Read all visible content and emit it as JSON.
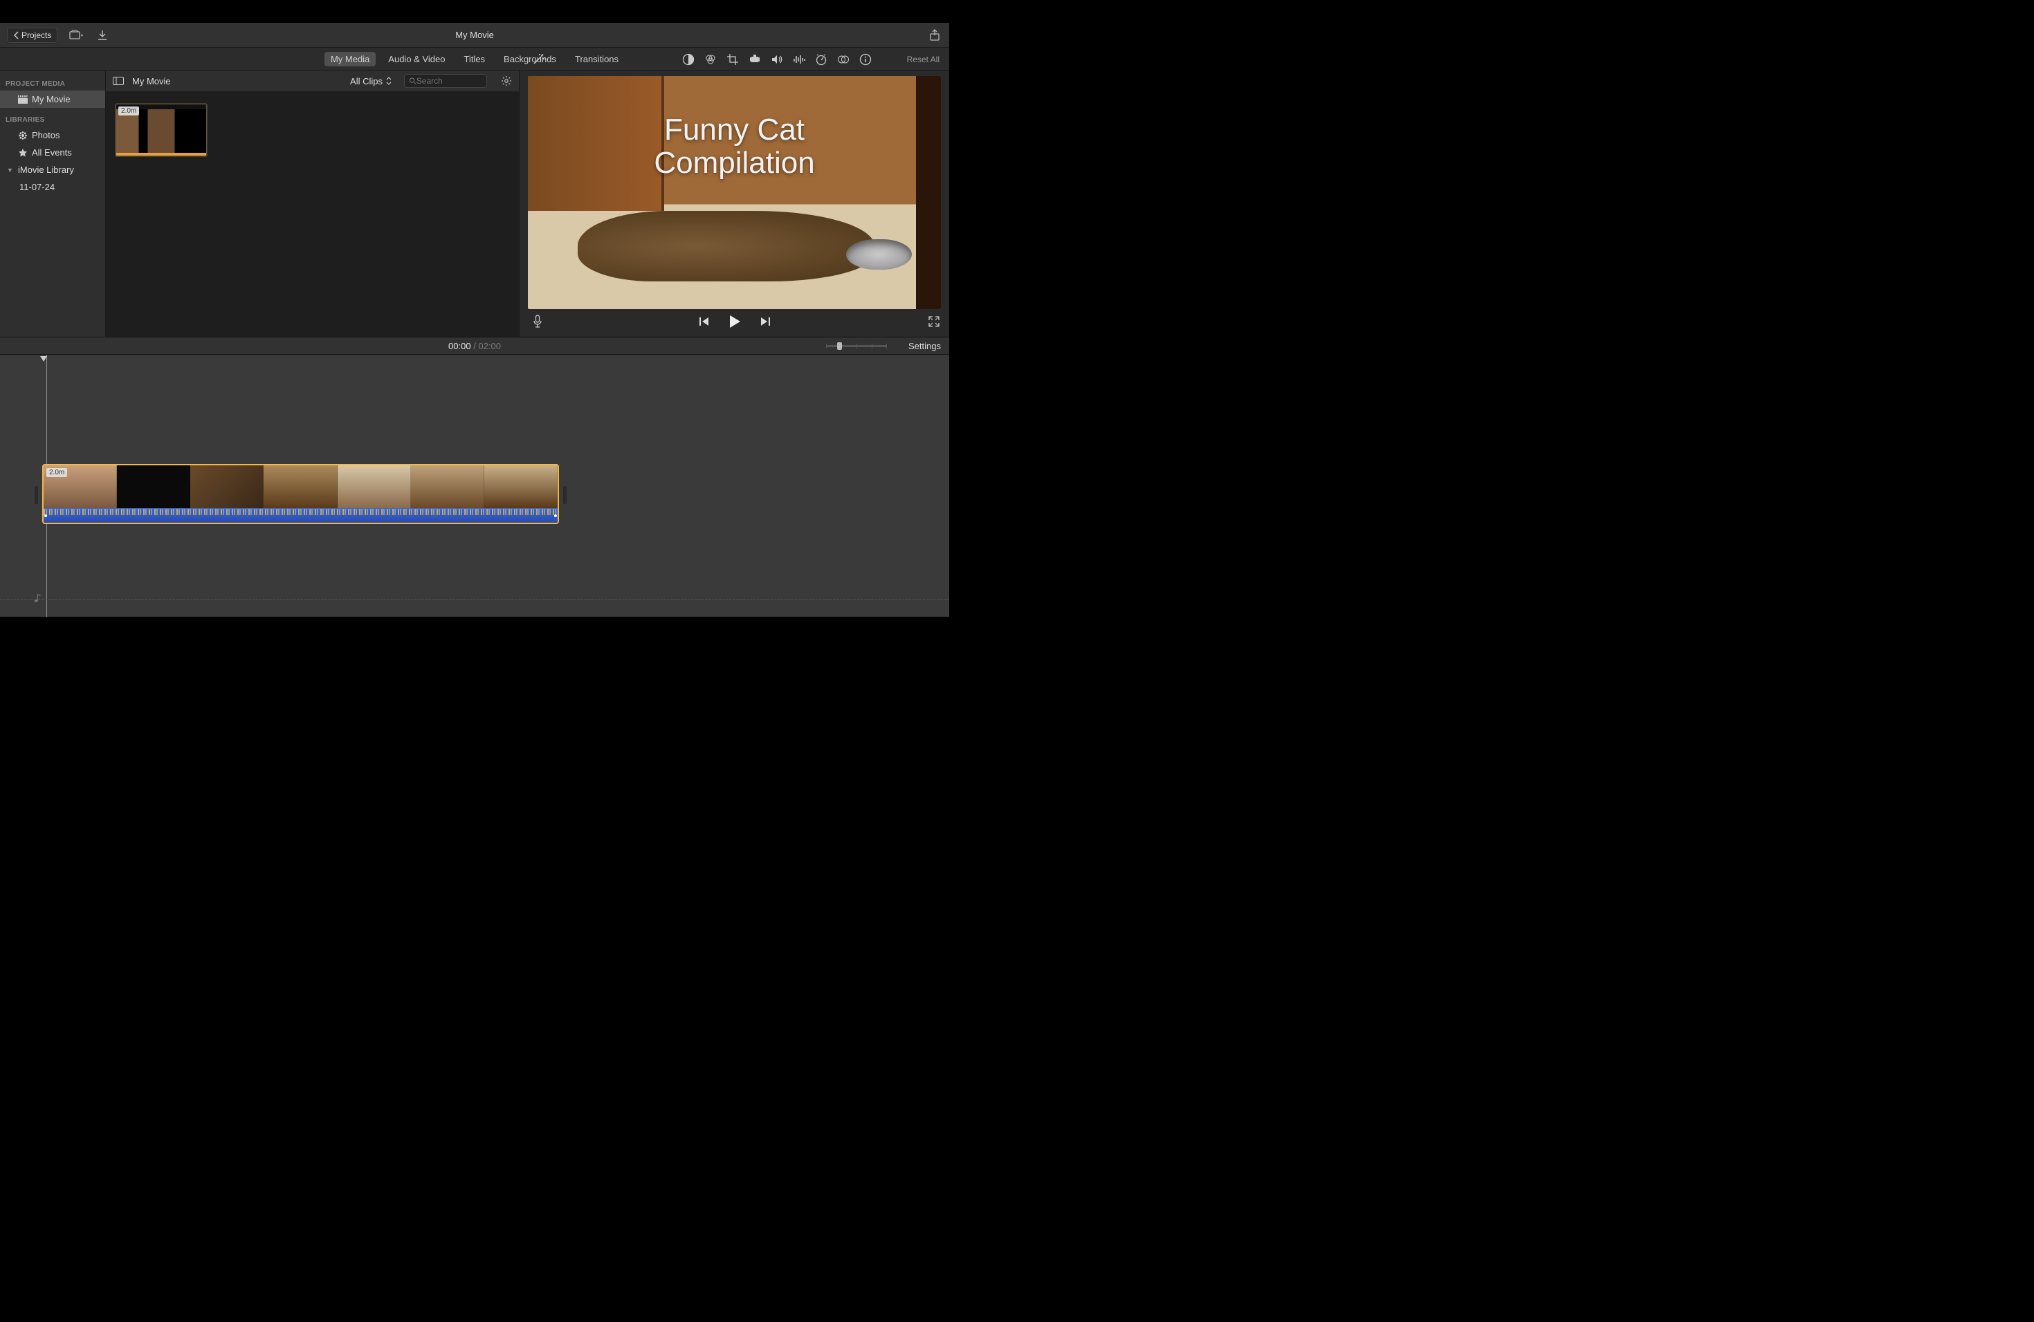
{
  "toolbar": {
    "back_label": "Projects",
    "title": "My Movie",
    "reset_label": "Reset All"
  },
  "tabs": {
    "my_media": "My Media",
    "audio_video": "Audio & Video",
    "titles": "Titles",
    "backgrounds": "Backgrounds",
    "transitions": "Transitions"
  },
  "sidebar": {
    "header_project": "PROJECT MEDIA",
    "project_name": "My Movie",
    "header_libraries": "LIBRARIES",
    "photos": "Photos",
    "all_events": "All Events",
    "imovie_library": "iMovie Library",
    "event_date": "11-07-24"
  },
  "browser": {
    "title": "My Movie",
    "filter_label": "All Clips",
    "search_placeholder": "Search",
    "clip_duration": "2.0m"
  },
  "preview": {
    "title_line1": "Funny Cat",
    "title_line2": "Compilation"
  },
  "timeline": {
    "current": "00:00",
    "sep": " / ",
    "total": "02:00",
    "settings_label": "Settings",
    "clip_duration": "2.0m"
  }
}
